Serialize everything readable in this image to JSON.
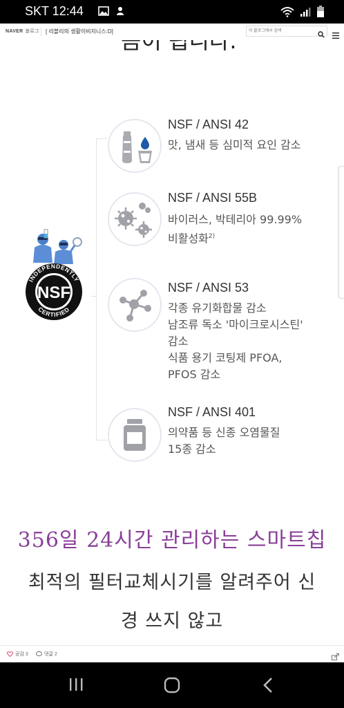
{
  "status_bar": {
    "carrier_time": "SKT 12:44"
  },
  "topbar": {
    "brand": "NAVER",
    "brand_blog": "블로그",
    "title": "[ 리블리의 생활이비지니스:D]",
    "search_placeholder": "이 블로그에서 검색"
  },
  "article": {
    "cut_heading": "듬이 됩니다.",
    "nsf_logo_text": "NSF",
    "nsf_ring_text": "INDEPENDENTLY CERTIFIED",
    "items": [
      {
        "title": "NSF / ANSI 42",
        "desc_lines": [
          "맛, 냄새 등 심미적 요인 감소"
        ],
        "icon": "water-bottle-icon"
      },
      {
        "title": "NSF / ANSI 55B",
        "desc_lines": [
          "바이러스, 박테리아 99.99%",
          "비활성화"
        ],
        "sup": "2)",
        "icon": "bacteria-icon"
      },
      {
        "title": "NSF / ANSI 53",
        "desc_lines": [
          "각종 유기화합물 감소",
          "남조류 독소 '마이크로시스틴'",
          "감소",
          "식품 용기 코팅제 PFOA,",
          "PFOS 감소"
        ],
        "icon": "molecule-icon"
      },
      {
        "title": "NSF / ANSI 401",
        "desc_lines": [
          "의약품 등 신종 오염물질",
          "15종 감소"
        ],
        "icon": "medicine-jar-icon"
      }
    ],
    "handwritten": {
      "line1": "356일 24시간 관리하는 스마트칩",
      "line2": "최적의 필터교체시기를 알려주어 신",
      "line3": "경 쓰지 않고"
    }
  },
  "bottom_bar": {
    "like_label": "공감 3",
    "comment_label": "댓글 2"
  },
  "colors": {
    "accent_purple": "#8a3f98",
    "icon_gray": "#9a9ca3",
    "drop_blue": "#1e5aa8",
    "nsf_person_blue": "#5b8ed6"
  }
}
